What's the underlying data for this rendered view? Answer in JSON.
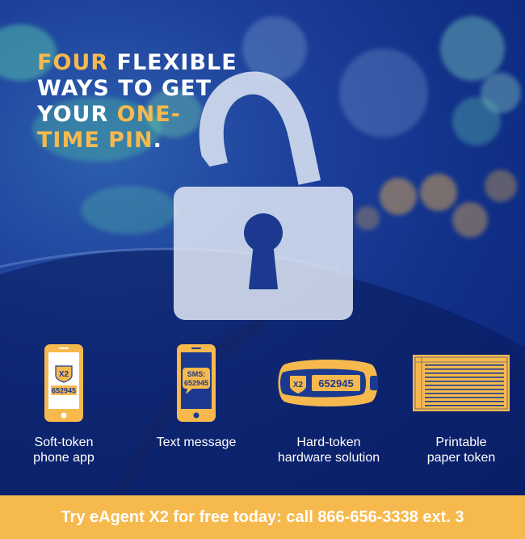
{
  "headline": {
    "line1_accent": "FOUR",
    "line1_rest": " FLEXIBLE",
    "line2": "WAYS TO GET",
    "line3_start": "YOUR ",
    "line3_accent": "ONE-",
    "line4_accent": "TIME PIN",
    "line4_end": "."
  },
  "colors": {
    "accent": "#f6b94d",
    "background": "#102f86",
    "text": "#ffffff"
  },
  "options": [
    {
      "label_line1": "Soft-token",
      "label_line2": "phone app",
      "icon": "phone-icon",
      "badge": "X2",
      "pin": "652945"
    },
    {
      "label_line1": "Text message",
      "label_line2": "",
      "icon": "sms-phone-icon",
      "sms_label": "SMS:",
      "pin": "652945"
    },
    {
      "label_line1": "Hard-token",
      "label_line2": "hardware solution",
      "icon": "keyfob-icon",
      "badge": "X2",
      "pin": "652945"
    },
    {
      "label_line1": "Printable",
      "label_line2": "paper token",
      "icon": "paper-token-icon"
    }
  ],
  "banner": {
    "text": "Try eAgent X2 for free today: call 866-656-3338 ext. 3"
  }
}
